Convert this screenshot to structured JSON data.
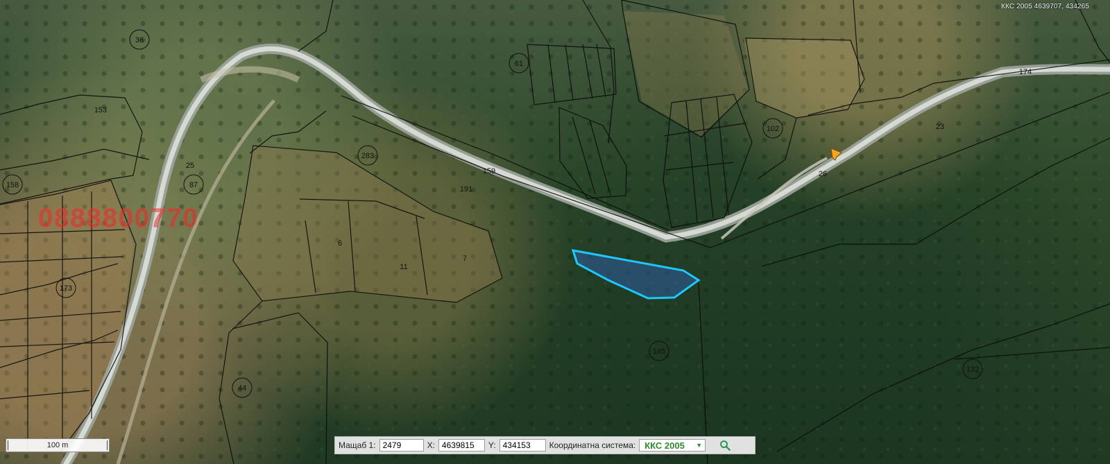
{
  "map": {
    "coordinate_readout": "ККС 2005 4639707, 434265",
    "watermark": "0888800770",
    "scale_bar_label": "100 m",
    "highlight_color": "#1ec8ff",
    "labels": [
      {
        "id": "parcel-36",
        "text": "36"
      },
      {
        "id": "parcel-153",
        "text": "153"
      },
      {
        "id": "parcel-158",
        "text": "158"
      },
      {
        "id": "parcel-87",
        "text": "87"
      },
      {
        "id": "parcel-173",
        "text": "173"
      },
      {
        "id": "parcel-283",
        "text": "283"
      },
      {
        "id": "parcel-61",
        "text": "61"
      },
      {
        "id": "parcel-102",
        "text": "102"
      },
      {
        "id": "parcel-145",
        "text": "145"
      },
      {
        "id": "parcel-44",
        "text": "44"
      },
      {
        "id": "parcel-132",
        "text": "132"
      },
      {
        "id": "parcel-174",
        "text": "174"
      },
      {
        "id": "parcel-26",
        "text": "26"
      },
      {
        "id": "parcel-23",
        "text": "23"
      },
      {
        "id": "parcel-191",
        "text": "191"
      },
      {
        "id": "parcel-159",
        "text": "159"
      },
      {
        "id": "parcel-25",
        "text": "25"
      },
      {
        "id": "parcel-11",
        "text": "11"
      },
      {
        "id": "parcel-7",
        "text": "7"
      },
      {
        "id": "parcel-6",
        "text": "6"
      }
    ]
  },
  "toolbar": {
    "scale_label": "Мащаб 1:",
    "scale_value": "2479",
    "x_label": "X:",
    "x_value": "4639815",
    "y_label": "Y:",
    "y_value": "434153",
    "coordinate_system_label": "Координатна система:",
    "coordinate_system_value": "ККС 2005",
    "dropdown_icon": "▼",
    "search_icon": "search-icon",
    "accent_color": "#2d8c2d"
  }
}
